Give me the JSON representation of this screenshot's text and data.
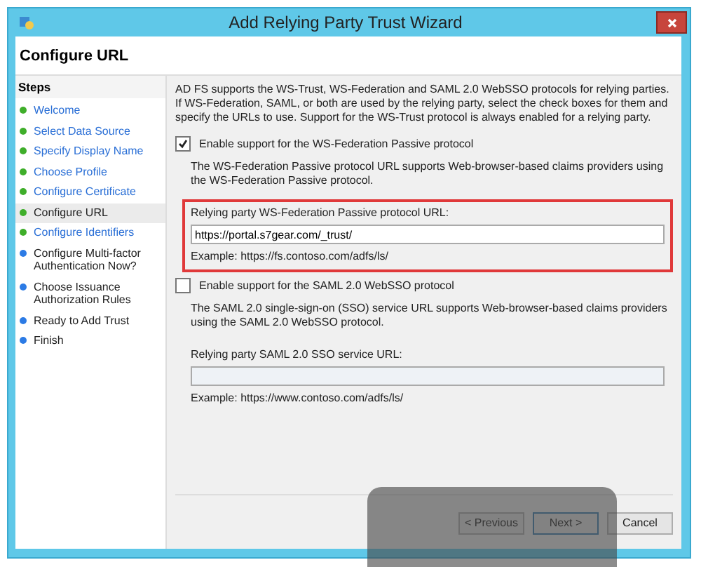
{
  "window": {
    "title": "Add Relying Party Trust Wizard"
  },
  "header": {
    "title": "Configure URL"
  },
  "steps": {
    "title": "Steps",
    "items": [
      {
        "label": "Welcome",
        "kind": "done",
        "selected": false
      },
      {
        "label": "Select Data Source",
        "kind": "done",
        "selected": false
      },
      {
        "label": "Specify Display Name",
        "kind": "done",
        "selected": false
      },
      {
        "label": "Choose Profile",
        "kind": "done",
        "selected": false
      },
      {
        "label": "Configure Certificate",
        "kind": "done",
        "selected": false
      },
      {
        "label": "Configure URL",
        "kind": "done",
        "selected": true
      },
      {
        "label": "Configure Identifiers",
        "kind": "done",
        "selected": false
      },
      {
        "label": "Configure Multi-factor Authentication Now?",
        "kind": "pending",
        "selected": false
      },
      {
        "label": "Choose Issuance Authorization Rules",
        "kind": "pending",
        "selected": false
      },
      {
        "label": "Ready to Add Trust",
        "kind": "pending",
        "selected": false
      },
      {
        "label": "Finish",
        "kind": "pending",
        "selected": false
      }
    ]
  },
  "intro": "AD FS supports the WS-Trust, WS-Federation and SAML 2.0 WebSSO protocols for relying parties.  If WS-Federation, SAML, or both are used by the relying party, select the check boxes for them and specify the URLs to use.  Support for the WS-Trust protocol is always enabled for a relying party.",
  "sections": [
    {
      "checkbox": "Enable support for the WS-Federation Passive protocol",
      "checked": true,
      "description": "The WS-Federation Passive protocol URL supports Web-browser-based claims providers using the WS-Federation Passive protocol.",
      "field_label": "Relying party WS-Federation Passive protocol URL:",
      "value": "https://portal.s7gear.com/_trust/",
      "example": "Example: https://fs.contoso.com/adfs/ls/",
      "highlighted": true
    },
    {
      "checkbox": "Enable support for the SAML 2.0 WebSSO protocol",
      "checked": false,
      "description": "The SAML 2.0 single-sign-on (SSO) service URL supports Web-browser-based claims providers using the SAML 2.0 WebSSO protocol.",
      "field_label": "Relying party SAML 2.0 SSO service URL:",
      "example": "Example: https://www.contoso.com/adfs/ls/",
      "highlighted": false
    }
  ],
  "buttons": [
    "< Previous",
    "Next >",
    "Cancel"
  ]
}
